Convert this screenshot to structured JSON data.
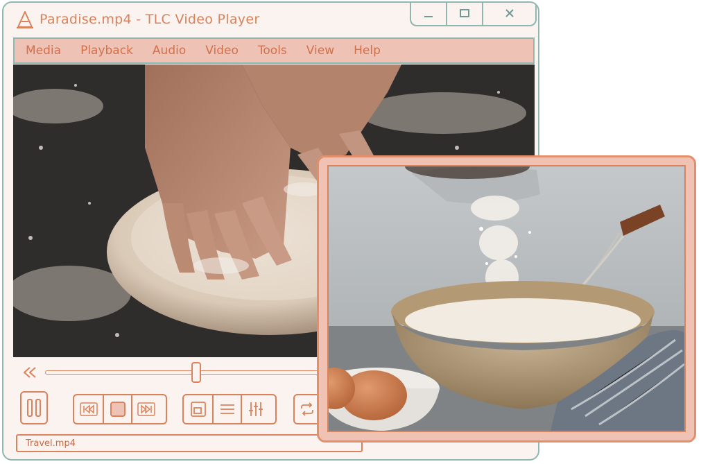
{
  "window": {
    "title": "Paradise.mp4 - TLC Video Player",
    "icon": "cone-icon",
    "controls": [
      "minimize",
      "maximize",
      "close"
    ]
  },
  "menu": [
    "Media",
    "Playback",
    "Audio",
    "Video",
    "Tools",
    "View",
    "Help"
  ],
  "player": {
    "progress": 0.52,
    "status_file": "Travel.mp4"
  },
  "colors": {
    "accent": "#d9825b",
    "menubar": "#efc2b6",
    "frame": "#8fb6b0",
    "pip_border": "#e38f6c"
  }
}
